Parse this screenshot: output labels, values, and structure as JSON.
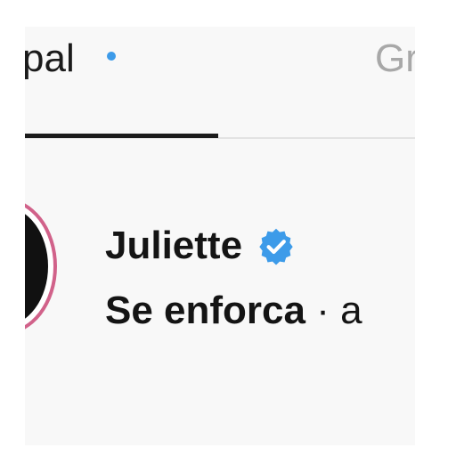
{
  "tabs": {
    "main_label": "pal",
    "second_label": "Gr"
  },
  "notification": {
    "has_new": true,
    "dot_color": "#3d9be9"
  },
  "profile": {
    "name": "Juliette",
    "verified": true,
    "verified_color": "#3d9be9",
    "story_ring_color": "#d1628a",
    "status_text": "Se enforca",
    "status_separator": " · a"
  }
}
